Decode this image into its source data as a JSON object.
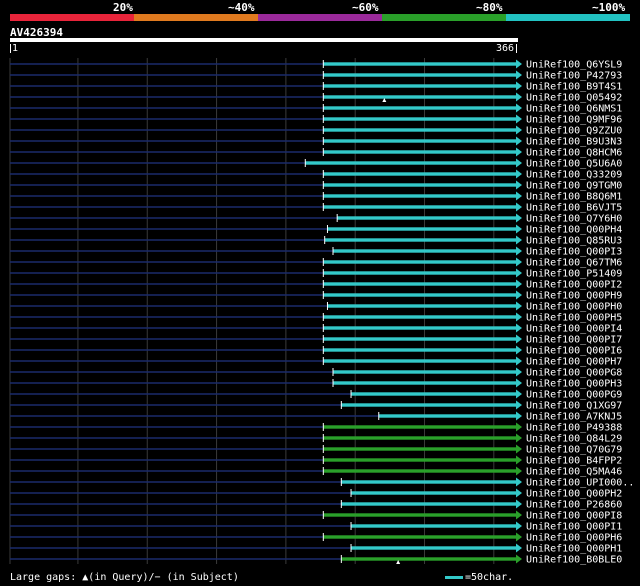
{
  "header": {
    "percent_labels": [
      "20%",
      "~40%",
      "~60%",
      "~80%",
      "~100%"
    ],
    "colors": [
      "#e8243a",
      "#e07a1f",
      "#9b2a9b",
      "#2aa02a",
      "#22c2c2"
    ],
    "query_id": "AV426394",
    "query_start": "1",
    "query_end": "366"
  },
  "hits": [
    {
      "name": "UniRef100_Q6YSL9",
      "start": 227,
      "color": "#33c9c9",
      "gap": null
    },
    {
      "name": "UniRef100_P42793",
      "start": 227,
      "color": "#33c9c9",
      "gap": null
    },
    {
      "name": "UniRef100_B9T4S1",
      "start": 227,
      "color": "#33c9c9",
      "gap": null
    },
    {
      "name": "UniRef100_Q05492",
      "start": 227,
      "color": "#33c9c9",
      "gap": 271
    },
    {
      "name": "UniRef100_Q6NMS1",
      "start": 227,
      "color": "#33c9c9",
      "gap": null
    },
    {
      "name": "UniRef100_Q9MF96",
      "start": 227,
      "color": "#33c9c9",
      "gap": null
    },
    {
      "name": "UniRef100_Q9ZZU0",
      "start": 227,
      "color": "#33c9c9",
      "gap": null
    },
    {
      "name": "UniRef100_B9U3N3",
      "start": 227,
      "color": "#33c9c9",
      "gap": null
    },
    {
      "name": "UniRef100_Q8HCM6",
      "start": 227,
      "color": "#33c9c9",
      "gap": null
    },
    {
      "name": "UniRef100_Q5U6A0",
      "start": 214,
      "color": "#33c9c9",
      "gap": null
    },
    {
      "name": "UniRef100_Q33209",
      "start": 227,
      "color": "#33c9c9",
      "gap": null
    },
    {
      "name": "UniRef100_Q9TGM0",
      "start": 227,
      "color": "#33c9c9",
      "gap": null
    },
    {
      "name": "UniRef100_B8Q6M1",
      "start": 227,
      "color": "#33c9c9",
      "gap": null
    },
    {
      "name": "UniRef100_B6VJT5",
      "start": 227,
      "color": "#33c9c9",
      "gap": null
    },
    {
      "name": "UniRef100_Q7Y6H0",
      "start": 237,
      "color": "#33c9c9",
      "gap": null
    },
    {
      "name": "UniRef100_Q00PH4",
      "start": 230,
      "color": "#33c9c9",
      "gap": null
    },
    {
      "name": "UniRef100_Q85RU3",
      "start": 228,
      "color": "#33c9c9",
      "gap": null
    },
    {
      "name": "UniRef100_Q00PI3",
      "start": 234,
      "color": "#33c9c9",
      "gap": null
    },
    {
      "name": "UniRef100_Q67TM6",
      "start": 227,
      "color": "#33c9c9",
      "gap": null
    },
    {
      "name": "UniRef100_P51409",
      "start": 227,
      "color": "#33c9c9",
      "gap": null
    },
    {
      "name": "UniRef100_Q00PI2",
      "start": 227,
      "color": "#33c9c9",
      "gap": null
    },
    {
      "name": "UniRef100_Q00PH9",
      "start": 227,
      "color": "#33c9c9",
      "gap": null
    },
    {
      "name": "UniRef100_Q00PH0",
      "start": 230,
      "color": "#33c9c9",
      "gap": null
    },
    {
      "name": "UniRef100_Q00PH5",
      "start": 227,
      "color": "#33c9c9",
      "gap": null
    },
    {
      "name": "UniRef100_Q00PI4",
      "start": 227,
      "color": "#33c9c9",
      "gap": null
    },
    {
      "name": "UniRef100_Q00PI7",
      "start": 227,
      "color": "#33c9c9",
      "gap": null
    },
    {
      "name": "UniRef100_Q00PI6",
      "start": 227,
      "color": "#33c9c9",
      "gap": null
    },
    {
      "name": "UniRef100_Q00PH7",
      "start": 227,
      "color": "#33c9c9",
      "gap": null
    },
    {
      "name": "UniRef100_Q00PG8",
      "start": 234,
      "color": "#33c9c9",
      "gap": null
    },
    {
      "name": "UniRef100_Q00PH3",
      "start": 234,
      "color": "#33c9c9",
      "gap": null
    },
    {
      "name": "UniRef100_Q00PG9",
      "start": 247,
      "color": "#33c9c9",
      "gap": null
    },
    {
      "name": "UniRef100_Q1XG97",
      "start": 240,
      "color": "#33c9c9",
      "gap": null
    },
    {
      "name": "UniRef100_A7KNJ5",
      "start": 267,
      "color": "#33c9c9",
      "gap": null
    },
    {
      "name": "UniRef100_P49388",
      "start": 227,
      "color": "#2aa02a",
      "gap": null
    },
    {
      "name": "UniRef100_Q84L29",
      "start": 227,
      "color": "#2aa02a",
      "gap": null
    },
    {
      "name": "UniRef100_Q70G79",
      "start": 227,
      "color": "#2aa02a",
      "gap": null
    },
    {
      "name": "UniRef100_B4FPP2",
      "start": 227,
      "color": "#2aa02a",
      "gap": null
    },
    {
      "name": "UniRef100_Q5MA46",
      "start": 227,
      "color": "#2aa02a",
      "gap": null
    },
    {
      "name": "UniRef100_UPI000..",
      "start": 240,
      "color": "#33c9c9",
      "gap": null
    },
    {
      "name": "UniRef100_Q00PH2",
      "start": 247,
      "color": "#33c9c9",
      "gap": null
    },
    {
      "name": "UniRef100_P26860",
      "start": 240,
      "color": "#33c9c9",
      "gap": null
    },
    {
      "name": "UniRef100_Q00PI8",
      "start": 227,
      "color": "#2aa02a",
      "gap": null
    },
    {
      "name": "UniRef100_Q00PI1",
      "start": 247,
      "color": "#33c9c9",
      "gap": null
    },
    {
      "name": "UniRef100_Q00PH6",
      "start": 227,
      "color": "#2aa02a",
      "gap": null
    },
    {
      "name": "UniRef100_Q00PH1",
      "start": 247,
      "color": "#33c9c9",
      "gap": null
    },
    {
      "name": "UniRef100_B0BLE0",
      "start": 240,
      "color": "#2aa02a",
      "gap": 281
    }
  ],
  "footer": {
    "legend_prefix": "Large gaps:",
    "legend_query": "(in Query)/",
    "legend_subject": "(in Subject)",
    "scale_text": "=50char."
  }
}
